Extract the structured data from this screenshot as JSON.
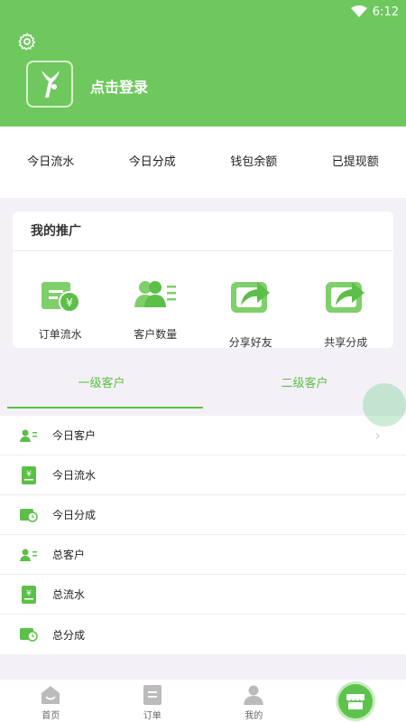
{
  "status": {
    "time": "6:12"
  },
  "header": {
    "login_label": "点击登录"
  },
  "stats": [
    {
      "label": "今日流水"
    },
    {
      "label": "今日分成"
    },
    {
      "label": "钱包余额"
    },
    {
      "label": "已提现额"
    }
  ],
  "promo": {
    "title": "我的推广",
    "items": [
      {
        "label": "订单流水",
        "icon": "wallet-yen-icon"
      },
      {
        "label": "客户数量",
        "icon": "customers-icon"
      },
      {
        "label": "分享好友",
        "icon": "share-icon"
      },
      {
        "label": "共享分成",
        "icon": "share-icon"
      }
    ]
  },
  "tabs": [
    {
      "label": "一级客户",
      "active": true
    },
    {
      "label": "二级客户",
      "active": false
    }
  ],
  "list": [
    {
      "label": "今日客户",
      "icon": "user-list-icon"
    },
    {
      "label": "今日流水",
      "icon": "yen-receipt-icon"
    },
    {
      "label": "今日分成",
      "icon": "wallet-clock-icon"
    },
    {
      "label": "总客户",
      "icon": "user-list-icon"
    },
    {
      "label": "总流水",
      "icon": "yen-receipt-icon"
    },
    {
      "label": "总分成",
      "icon": "wallet-clock-icon"
    }
  ],
  "bottom_nav": [
    {
      "label": "首页",
      "icon": "home-icon"
    },
    {
      "label": "订单",
      "icon": "order-icon"
    },
    {
      "label": "我的",
      "icon": "person-icon"
    },
    {
      "label": "",
      "icon": "store-icon",
      "active": true
    }
  ],
  "colors": {
    "brand": "#6fc85e",
    "accent": "#5cbf48"
  }
}
